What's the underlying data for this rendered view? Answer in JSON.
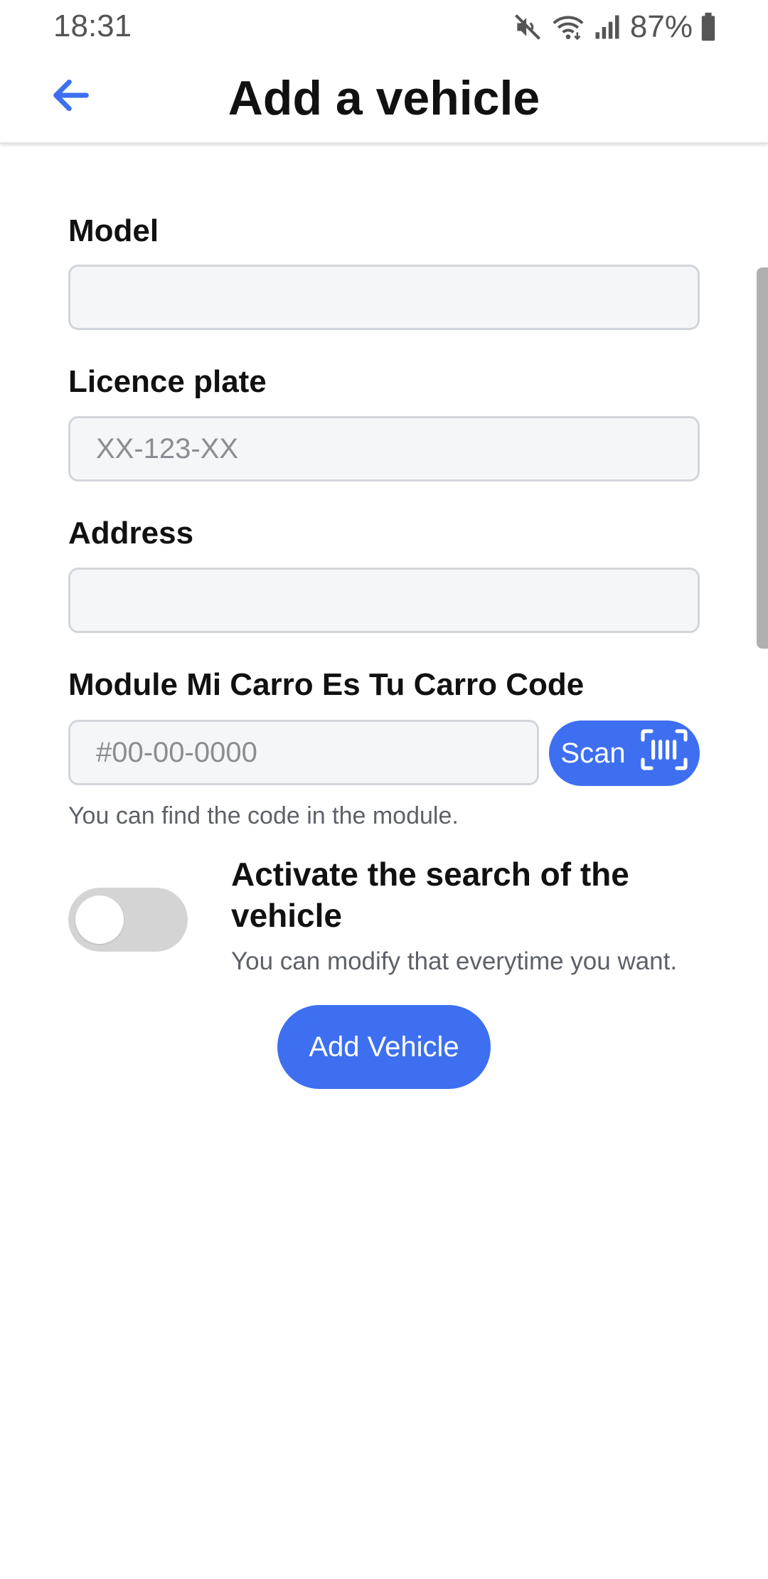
{
  "status_bar": {
    "time": "18:31",
    "battery": "87%",
    "icons": [
      "mute-icon",
      "wifi-icon",
      "signal-icon",
      "battery-icon"
    ]
  },
  "header": {
    "title": "Add a vehicle",
    "back_icon": "arrow-left-icon"
  },
  "form": {
    "model": {
      "label": "Model",
      "value": "",
      "placeholder": ""
    },
    "plate": {
      "label": "Licence plate",
      "value": "",
      "placeholder": "XX-123-XX"
    },
    "address": {
      "label": "Address",
      "value": "",
      "placeholder": ""
    },
    "code": {
      "label": "Module Mi Carro Es Tu Carro Code",
      "value": "",
      "placeholder": "#00-00-0000",
      "scan_label": "Scan",
      "scan_icon": "barcode-scan-icon",
      "helper": "You can find the code in the module."
    },
    "search": {
      "title": "Activate the search of the vehicle",
      "subtitle": "You can modify that everytime you want.",
      "enabled": false
    },
    "submit_label": "Add Vehicle"
  },
  "colors": {
    "accent": "#3d6ff0",
    "input_bg": "#f5f6f8",
    "input_border": "#d2d5da",
    "toggle_off": "#d4d4d4",
    "muted_text": "#5d6168"
  }
}
